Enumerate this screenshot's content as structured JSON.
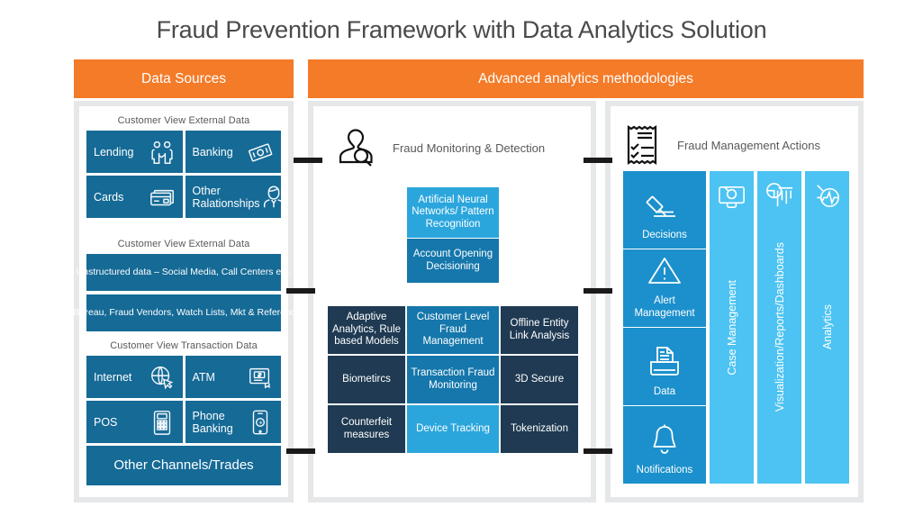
{
  "title": "Fraud Prevention Framework with Data Analytics Solution",
  "colors": {
    "orange": "#F47B28",
    "panel_gray": "#e6e7e9",
    "tile_blue": "#156a96",
    "cell_dark": "#1f3a52",
    "cell_mid": "#1577ab",
    "cell_light": "#2ba6dd",
    "right_tile": "#1b90cc",
    "vbar": "#4cc3f2",
    "connector": "#1a1a1a",
    "title_text": "#4a4a4a"
  },
  "headers": {
    "left": "Data Sources",
    "right": "Advanced analytics methodologies"
  },
  "data_sources": {
    "groups": [
      {
        "title": "Customer View External Data",
        "tiles": [
          {
            "label": "Lending",
            "icon": "handshake-icon"
          },
          {
            "label": "Banking",
            "icon": "banknote-icon"
          },
          {
            "label": "Cards",
            "icon": "credit-card-icon"
          },
          {
            "label": "Other Ralationships",
            "icon": "person-tie-icon"
          }
        ]
      },
      {
        "title": "Customer View External Data",
        "bands": [
          "Unstructured data – Social Media, Call Centers etc.",
          "Credit Bureau, Fraud Vendors, Watch Lists, Mkt & Reference data"
        ]
      },
      {
        "title": "Customer View Transaction Data",
        "tiles": [
          {
            "label": "Internet",
            "icon": "globe-cursor-icon"
          },
          {
            "label": "ATM",
            "icon": "atm-icon"
          },
          {
            "label": "POS",
            "icon": "pos-terminal-icon"
          },
          {
            "label": "Phone Banking",
            "icon": "mobile-phone-icon"
          }
        ],
        "wide": "Other Channels/Trades"
      }
    ]
  },
  "middle": {
    "heading": "Fraud Monitoring & Detection",
    "heading_icon": "person-magnifier-icon",
    "stack": [
      {
        "label": "Artificial Neural Networks/ Pattern Recognition",
        "tone": "light"
      },
      {
        "label": "Account Opening Decisioning",
        "tone": "mid"
      }
    ],
    "matrix": [
      [
        {
          "label": "Adaptive Analytics, Rule based Models",
          "tone": "dark"
        },
        {
          "label": "Customer Level Fraud Management",
          "tone": "mid"
        },
        {
          "label": "Offline Entity Link Analysis",
          "tone": "dark"
        }
      ],
      [
        {
          "label": "Biometircs",
          "tone": "dark"
        },
        {
          "label": "Transaction Fraud Monitoring",
          "tone": "mid"
        },
        {
          "label": "3D Secure",
          "tone": "dark"
        }
      ],
      [
        {
          "label": "Counterfeit measures",
          "tone": "dark"
        },
        {
          "label": "Device Tracking",
          "tone": "light"
        },
        {
          "label": "Tokenization",
          "tone": "dark"
        }
      ]
    ]
  },
  "right": {
    "heading": "Fraud Management Actions",
    "heading_icon": "checklist-document-icon",
    "tiles": [
      {
        "label": "Decisions",
        "icon": "gavel-icon"
      },
      {
        "label": "Alert Management",
        "icon": "warning-triangle-icon"
      },
      {
        "label": "Data",
        "icon": "folder-document-icon"
      },
      {
        "label": "Notifications",
        "icon": "bell-icon"
      }
    ],
    "bars": [
      {
        "label": "Case Management",
        "icon": "briefcase-magnifier-icon"
      },
      {
        "label": "Visualization/Reports/Dashboards",
        "icon": "bar-pie-chart-icon"
      },
      {
        "label": "Analytics",
        "icon": "pulse-magnifier-icon"
      }
    ]
  }
}
